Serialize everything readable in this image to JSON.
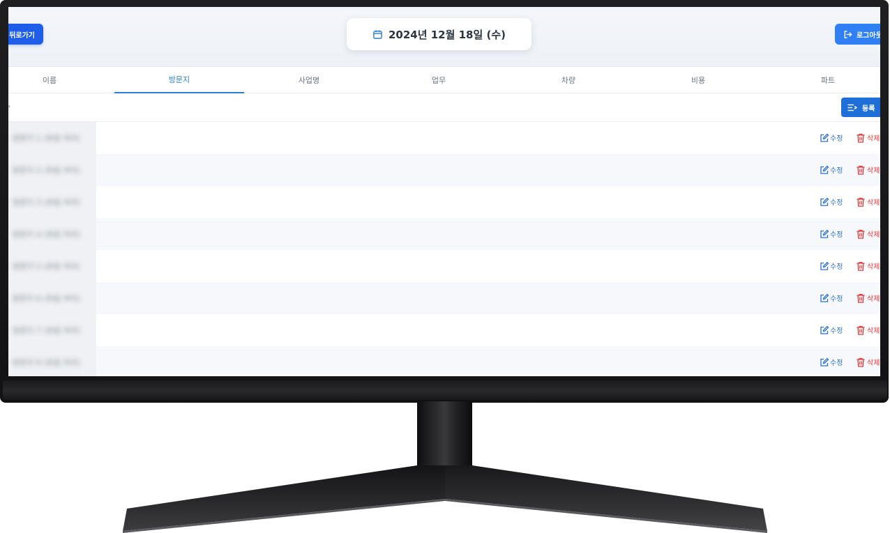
{
  "header": {
    "back_label": "뒤로가기",
    "date_label": "2024년 12월 18일 (수)",
    "logout_label": "로그아웃",
    "accent_color": "#1e5ee8"
  },
  "tabs": [
    {
      "label": "이름",
      "active": false
    },
    {
      "label": "방문지",
      "active": true
    },
    {
      "label": "사업명",
      "active": false
    },
    {
      "label": "업무",
      "active": false
    },
    {
      "label": "차량",
      "active": false
    },
    {
      "label": "비용",
      "active": false
    },
    {
      "label": "파트",
      "active": false
    }
  ],
  "toolbar": {
    "left_stub": "¬",
    "register_label": "등록"
  },
  "rows": [
    {
      "name": "방문지 1 (흐림 처리)",
      "edit_label": "수정",
      "delete_label": "삭제"
    },
    {
      "name": "방문지 2 (흐림 처리)",
      "edit_label": "수정",
      "delete_label": "삭제"
    },
    {
      "name": "방문지 3 (흐림 처리)",
      "edit_label": "수정",
      "delete_label": "삭제"
    },
    {
      "name": "방문지 4 (흐림 처리)",
      "edit_label": "수정",
      "delete_label": "삭제"
    },
    {
      "name": "방문지 5 (흐림 처리)",
      "edit_label": "수정",
      "delete_label": "삭제"
    },
    {
      "name": "방문지 6 (흐림 처리)",
      "edit_label": "수정",
      "delete_label": "삭제"
    },
    {
      "name": "방문지 7 (흐림 처리)",
      "edit_label": "수정",
      "delete_label": "삭제"
    },
    {
      "name": "방문지 8 (흐림 처리)",
      "edit_label": "수정",
      "delete_label": "삭제"
    }
  ]
}
